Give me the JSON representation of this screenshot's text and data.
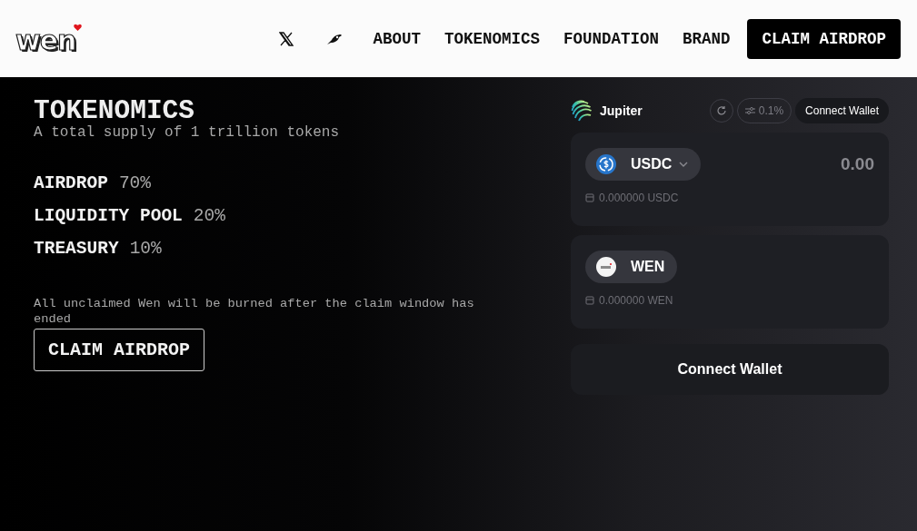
{
  "header": {
    "logo": "wen",
    "nav": [
      {
        "kind": "x-link"
      },
      {
        "kind": "bird-link"
      },
      {
        "kind": "text",
        "label": "ABOUT"
      },
      {
        "kind": "text",
        "label": "TOKENOMICS"
      },
      {
        "kind": "text",
        "label": "FOUNDATION"
      },
      {
        "kind": "text",
        "label": "BRAND"
      },
      {
        "kind": "primary",
        "label": "CLAIM AIRDROP"
      }
    ]
  },
  "tokenomics": {
    "title": "TOKENOMICS",
    "subtitle": "A total supply of 1 trillion tokens",
    "allocations": [
      {
        "name": "AIRDROP",
        "share": "70%"
      },
      {
        "name": "LIQUIDITY POOL",
        "share": "20%"
      },
      {
        "name": "TREASURY",
        "share": "10%"
      }
    ],
    "note": "All unclaimed Wen will be burned after the claim window has ended",
    "button": "CLAIM AIRDROP"
  },
  "swap": {
    "brand": "Jupiter",
    "slippage": "0.1%",
    "connect": "Connect Wallet",
    "tokens": [
      {
        "kind": "usdc",
        "symbol": "USDC",
        "dropdown": true,
        "amount": "0.00",
        "balance": "0.000000 USDC"
      },
      {
        "kind": "wen",
        "symbol": "WEN",
        "dropdown": false,
        "balance": "0.000000 WEN"
      }
    ],
    "action": "Connect Wallet"
  }
}
